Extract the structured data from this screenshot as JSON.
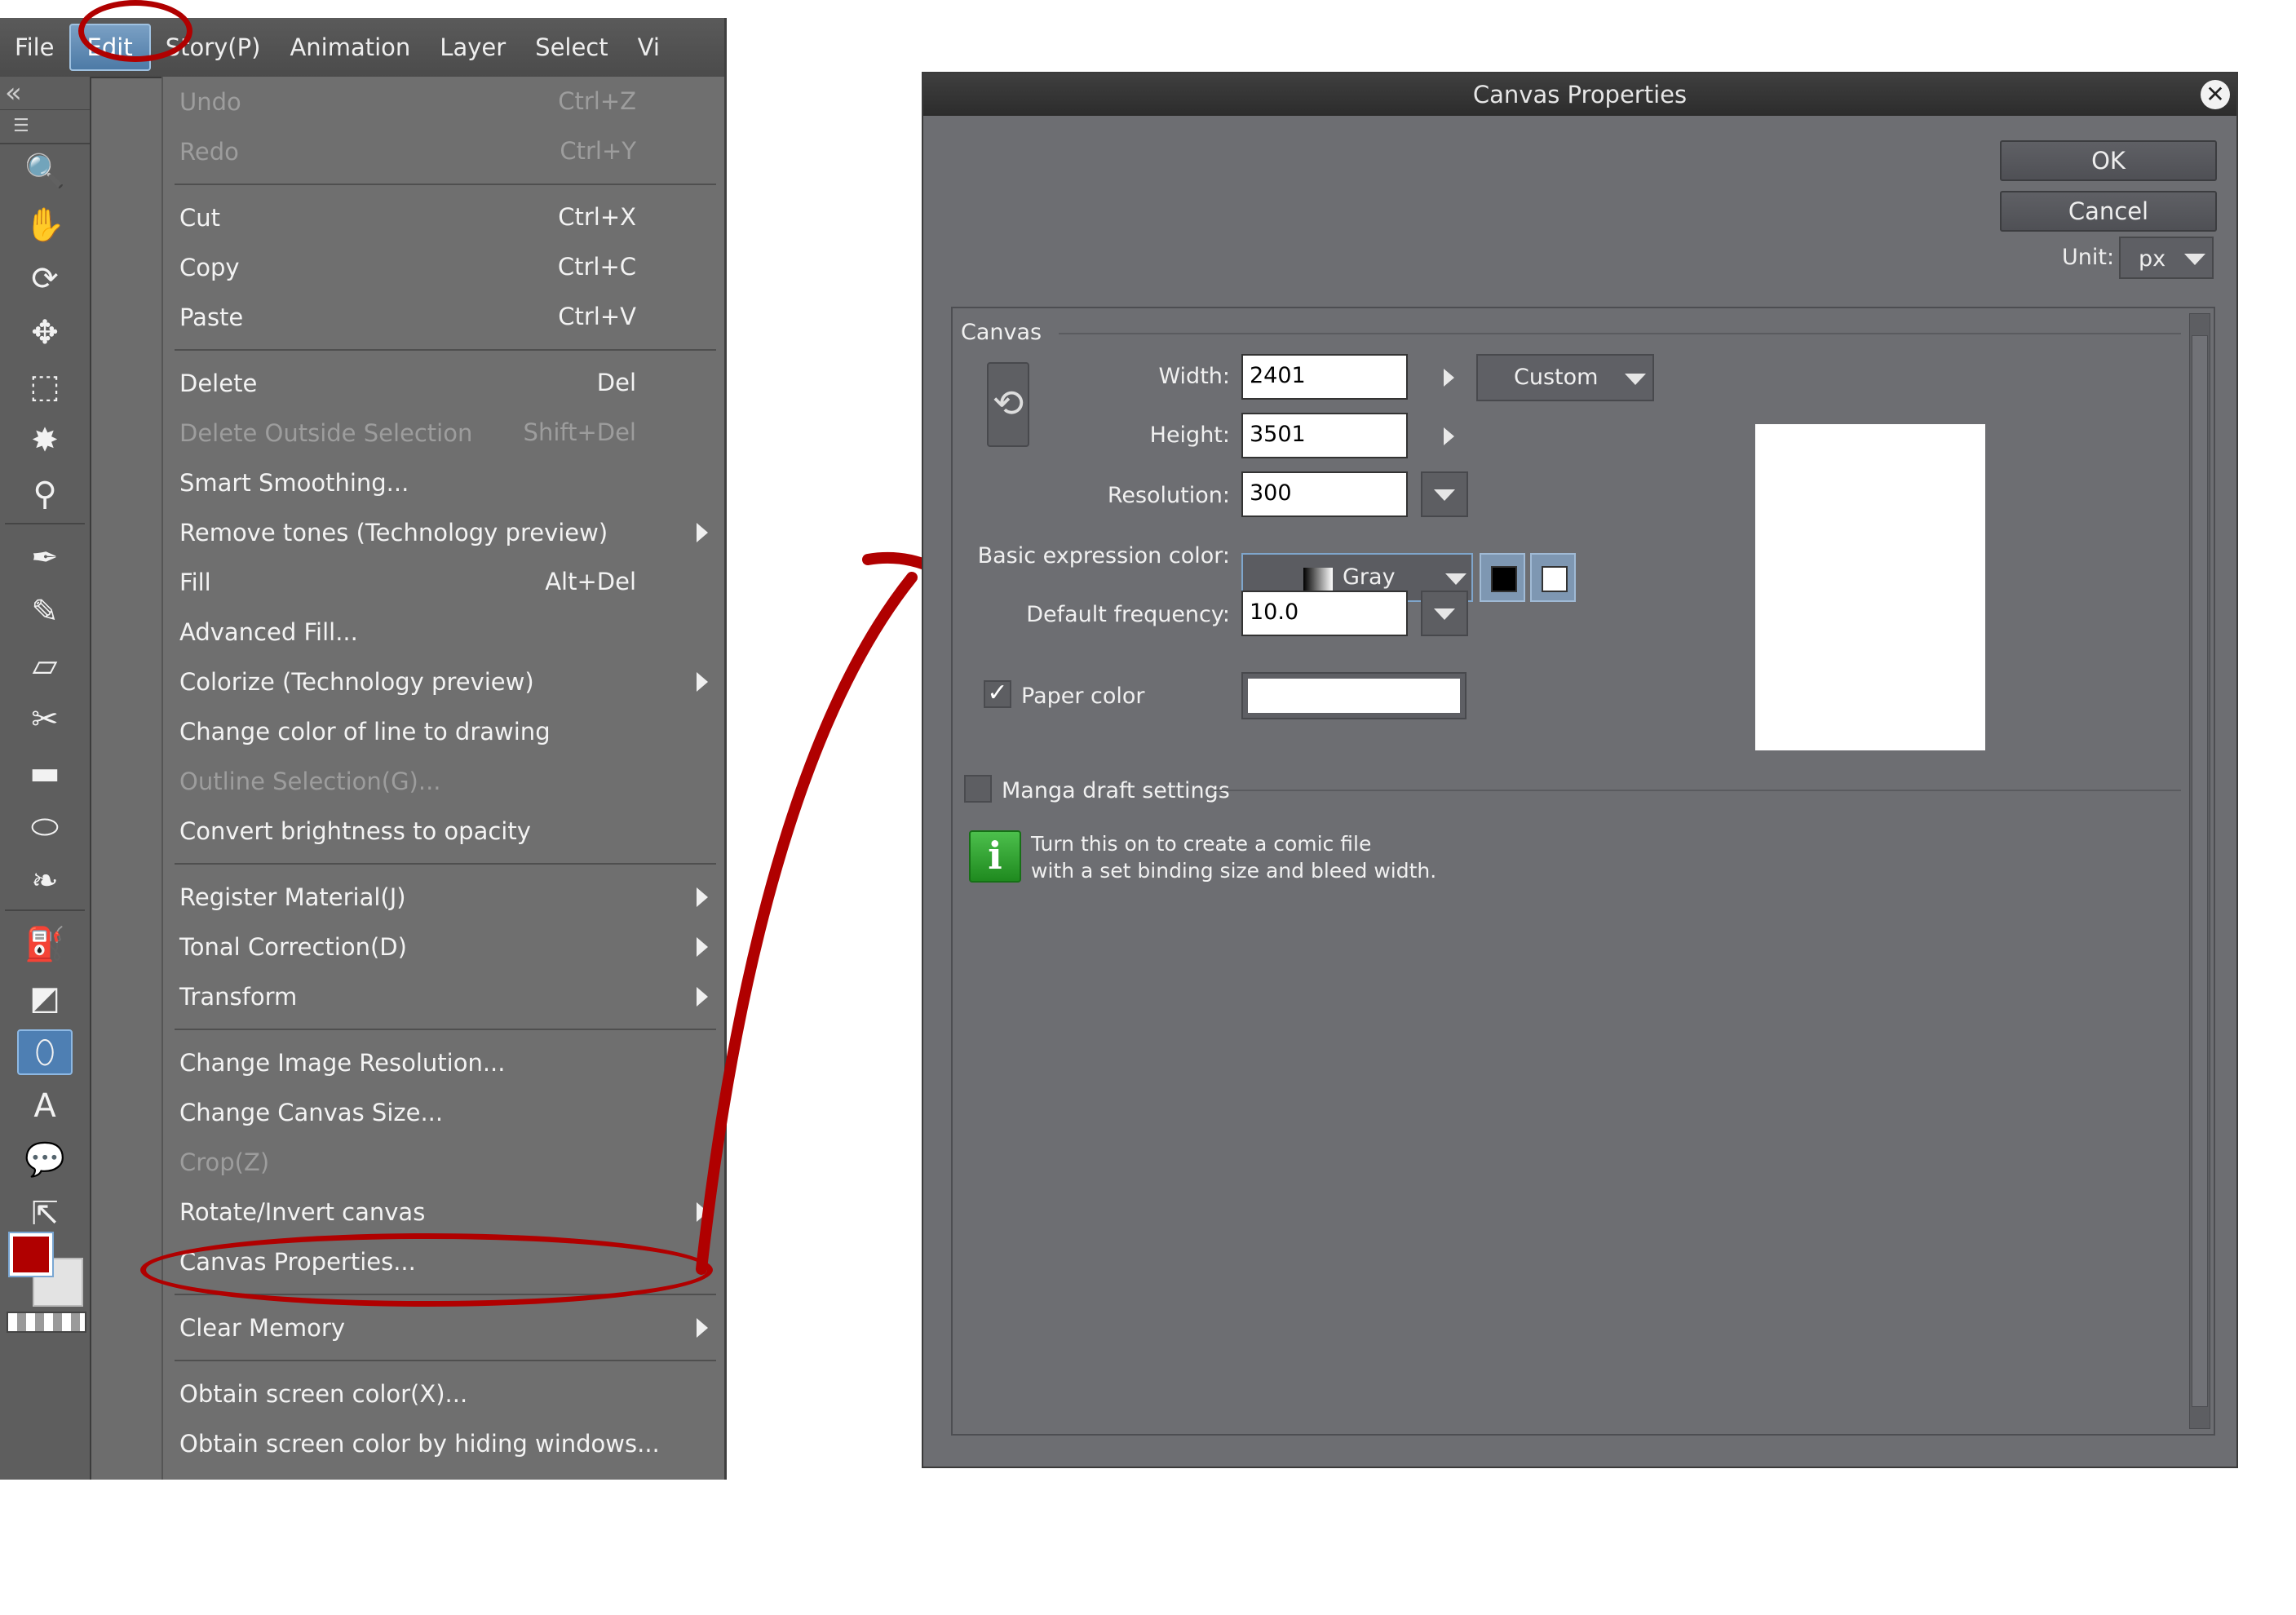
{
  "menubar": {
    "items": [
      "File",
      "Edit",
      "Story(P)",
      "Animation",
      "Layer",
      "Select",
      "Vi"
    ]
  },
  "toolbar": {
    "tools": [
      "zoom-icon",
      "hand-icon",
      "rotate-view-icon",
      "move-layer-icon",
      "rectangle-selection-icon",
      "magic-wand-icon",
      "eyedropper-icon",
      "pen-icon",
      "brush-icon",
      "eraser-icon",
      "decoration-icon",
      "ruler-stripes-icon",
      "blend-icon",
      "liquify-icon",
      "fill-bucket-icon",
      "gradient-icon",
      "ellipse-icon",
      "text-icon",
      "balloon-icon",
      "frame-border-icon"
    ],
    "main_color": "#b00000",
    "sub_color": "#e3e3e3"
  },
  "edit_menu": {
    "groups": [
      [
        {
          "label": "Undo",
          "shortcut": "Ctrl+Z",
          "disabled": true
        },
        {
          "label": "Redo",
          "shortcut": "Ctrl+Y",
          "disabled": true
        }
      ],
      [
        {
          "label": "Cut",
          "shortcut": "Ctrl+X"
        },
        {
          "label": "Copy",
          "shortcut": "Ctrl+C"
        },
        {
          "label": "Paste",
          "shortcut": "Ctrl+V"
        }
      ],
      [
        {
          "label": "Delete",
          "shortcut": "Del"
        },
        {
          "label": "Delete Outside Selection",
          "shortcut": "Shift+Del",
          "disabled": true
        },
        {
          "label": "Smart Smoothing..."
        },
        {
          "label": "Remove tones (Technology preview)",
          "submenu": true
        },
        {
          "label": "Fill",
          "shortcut": "Alt+Del"
        },
        {
          "label": "Advanced Fill..."
        },
        {
          "label": "Colorize (Technology preview)",
          "submenu": true
        },
        {
          "label": "Change color of line to drawing"
        },
        {
          "label": "Outline Selection(G)...",
          "disabled": true
        },
        {
          "label": "Convert brightness to opacity"
        }
      ],
      [
        {
          "label": "Register Material(J)",
          "submenu": true
        },
        {
          "label": "Tonal Correction(D)",
          "submenu": true
        },
        {
          "label": "Transform",
          "submenu": true
        }
      ],
      [
        {
          "label": "Change Image Resolution..."
        },
        {
          "label": "Change Canvas Size..."
        },
        {
          "label": "Crop(Z)",
          "disabled": true
        },
        {
          "label": "Rotate/Invert canvas",
          "submenu": true
        },
        {
          "label": "Canvas Properties..."
        }
      ],
      [
        {
          "label": "Clear Memory",
          "submenu": true
        }
      ],
      [
        {
          "label": "Obtain screen color(X)..."
        },
        {
          "label": "Obtain screen color by hiding windows..."
        }
      ]
    ]
  },
  "annotation_color": "#b00000",
  "dialog": {
    "title": "Canvas Properties",
    "ok_label": "OK",
    "cancel_label": "Cancel",
    "unit_label": "Unit:",
    "unit_value": "px",
    "section_label": "Canvas",
    "width_label": "Width:",
    "width_value": "2401",
    "preset_value": "Custom",
    "height_label": "Height:",
    "height_value": "3501",
    "resolution_label": "Resolution:",
    "resolution_value": "300",
    "expression_label": "Basic expression color:",
    "expression_value": "Gray",
    "frequency_label": "Default frequency:",
    "frequency_value": "10.0",
    "paper_color_label": "Paper color",
    "paper_color_checked": true,
    "paper_color": "#ffffff",
    "manga_label": "Manga draft settings",
    "manga_checked": false,
    "info_line1": "Turn this on to create a comic file",
    "info_line2": "with a set binding size and bleed width."
  }
}
